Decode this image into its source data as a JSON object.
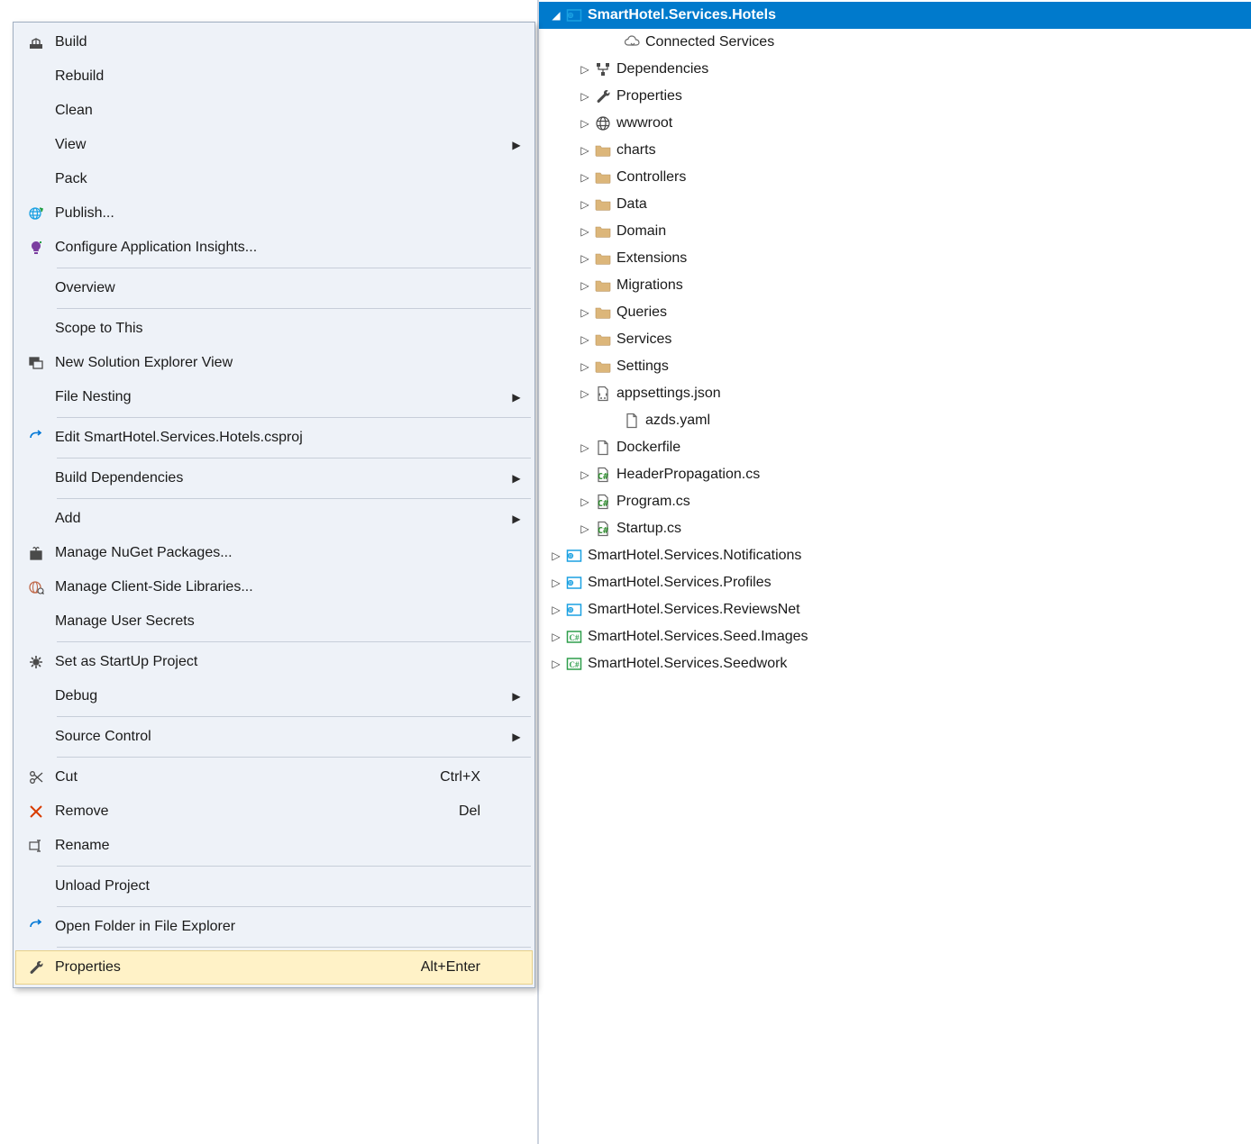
{
  "contextMenu": {
    "items": [
      {
        "label": "Build",
        "icon": "build-icon"
      },
      {
        "label": "Rebuild"
      },
      {
        "label": "Clean"
      },
      {
        "label": "View",
        "submenu": true
      },
      {
        "label": "Pack"
      },
      {
        "label": "Publish...",
        "icon": "publish-globe-icon"
      },
      {
        "label": "Configure Application Insights...",
        "icon": "insights-bulb-icon"
      },
      {
        "separator": true
      },
      {
        "label": "Overview"
      },
      {
        "separator": true
      },
      {
        "label": "Scope to This"
      },
      {
        "label": "New Solution Explorer View",
        "icon": "new-view-icon"
      },
      {
        "label": "File Nesting",
        "submenu": true
      },
      {
        "separator": true
      },
      {
        "label": "Edit SmartHotel.Services.Hotels.csproj",
        "icon": "edit-arrow-icon"
      },
      {
        "separator": true
      },
      {
        "label": "Build Dependencies",
        "submenu": true
      },
      {
        "separator": true
      },
      {
        "label": "Add",
        "submenu": true
      },
      {
        "label": "Manage NuGet Packages...",
        "icon": "nuget-gift-icon"
      },
      {
        "label": "Manage Client-Side Libraries...",
        "icon": "libman-globe-icon"
      },
      {
        "label": "Manage User Secrets"
      },
      {
        "separator": true
      },
      {
        "label": "Set as StartUp Project",
        "icon": "gear-icon"
      },
      {
        "label": "Debug",
        "submenu": true
      },
      {
        "separator": true
      },
      {
        "label": "Source Control",
        "submenu": true
      },
      {
        "separator": true
      },
      {
        "label": "Cut",
        "shortcut": "Ctrl+X",
        "icon": "scissors-icon"
      },
      {
        "label": "Remove",
        "shortcut": "Del",
        "icon": "remove-x-icon"
      },
      {
        "label": "Rename",
        "icon": "rename-icon"
      },
      {
        "separator": true
      },
      {
        "label": "Unload Project"
      },
      {
        "separator": true
      },
      {
        "label": "Open Folder in File Explorer",
        "icon": "open-folder-arrow-icon"
      },
      {
        "separator": true
      },
      {
        "label": "Properties",
        "shortcut": "Alt+Enter",
        "icon": "wrench-icon",
        "highlight": true
      }
    ]
  },
  "explorer": {
    "nodes": [
      {
        "depth": 0,
        "exp": "open",
        "icon": "csproj-blue-icon",
        "label": "SmartHotel.Services.Hotels",
        "selected": true
      },
      {
        "depth": 2,
        "exp": "none",
        "icon": "connected-services-icon",
        "label": "Connected Services"
      },
      {
        "depth": 1,
        "exp": "closed",
        "icon": "dependencies-icon",
        "label": "Dependencies"
      },
      {
        "depth": 1,
        "exp": "closed",
        "icon": "wrench-icon",
        "label": "Properties"
      },
      {
        "depth": 1,
        "exp": "closed",
        "icon": "globe-icon",
        "label": "wwwroot"
      },
      {
        "depth": 1,
        "exp": "closed",
        "icon": "folder-icon",
        "label": "charts"
      },
      {
        "depth": 1,
        "exp": "closed",
        "icon": "folder-icon",
        "label": "Controllers"
      },
      {
        "depth": 1,
        "exp": "closed",
        "icon": "folder-icon",
        "label": "Data"
      },
      {
        "depth": 1,
        "exp": "closed",
        "icon": "folder-icon",
        "label": "Domain"
      },
      {
        "depth": 1,
        "exp": "closed",
        "icon": "folder-icon",
        "label": "Extensions"
      },
      {
        "depth": 1,
        "exp": "closed",
        "icon": "folder-icon",
        "label": "Migrations"
      },
      {
        "depth": 1,
        "exp": "closed",
        "icon": "folder-icon",
        "label": "Queries"
      },
      {
        "depth": 1,
        "exp": "closed",
        "icon": "folder-icon",
        "label": "Services"
      },
      {
        "depth": 1,
        "exp": "closed",
        "icon": "folder-icon",
        "label": "Settings"
      },
      {
        "depth": 1,
        "exp": "closed",
        "icon": "json-file-icon",
        "label": "appsettings.json"
      },
      {
        "depth": 2,
        "exp": "none",
        "icon": "file-icon",
        "label": "azds.yaml"
      },
      {
        "depth": 1,
        "exp": "closed",
        "icon": "file-icon",
        "label": "Dockerfile"
      },
      {
        "depth": 1,
        "exp": "closed",
        "icon": "cs-file-icon",
        "label": "HeaderPropagation.cs"
      },
      {
        "depth": 1,
        "exp": "closed",
        "icon": "cs-file-icon",
        "label": "Program.cs"
      },
      {
        "depth": 1,
        "exp": "closed",
        "icon": "cs-file-icon",
        "label": "Startup.cs"
      },
      {
        "depth": 0,
        "exp": "closed",
        "icon": "csproj-blue-icon",
        "label": "SmartHotel.Services.Notifications"
      },
      {
        "depth": 0,
        "exp": "closed",
        "icon": "csproj-blue-icon",
        "label": "SmartHotel.Services.Profiles"
      },
      {
        "depth": 0,
        "exp": "closed",
        "icon": "csproj-blue-icon",
        "label": "SmartHotel.Services.ReviewsNet"
      },
      {
        "depth": 0,
        "exp": "closed",
        "icon": "csproj-green-icon",
        "label": "SmartHotel.Services.Seed.Images"
      },
      {
        "depth": 0,
        "exp": "closed",
        "icon": "csproj-green-icon",
        "label": "SmartHotel.Services.Seedwork"
      }
    ]
  }
}
